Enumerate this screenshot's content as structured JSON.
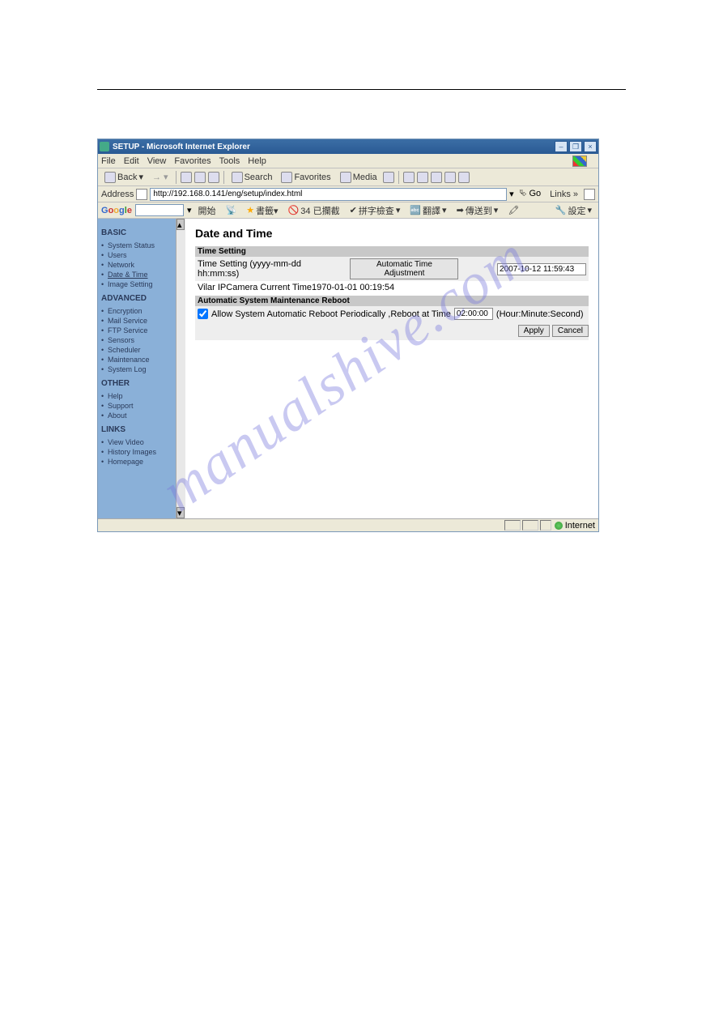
{
  "window": {
    "title": "SETUP - Microsoft Internet Explorer",
    "min": "–",
    "max": "❐",
    "close": "×"
  },
  "menubar": {
    "items": [
      "File",
      "Edit",
      "View",
      "Favorites",
      "Tools",
      "Help"
    ]
  },
  "toolbar": {
    "back": "Back",
    "search": "Search",
    "favorites": "Favorites",
    "media": "Media"
  },
  "addrbar": {
    "label": "Address",
    "url": "http://192.168.0.141/eng/setup/index.html",
    "go": "Go",
    "links": "Links »"
  },
  "googlebar": {
    "start": "開始",
    "count": "34 已攔截",
    "check": "拼字檢查",
    "trans": "翻譯",
    "send": "傳送到",
    "settings": "設定"
  },
  "sidebar": {
    "basic": {
      "title": "BASIC",
      "items": [
        "System Status",
        "Users",
        "Network",
        "Date & Time",
        "Image Setting"
      ],
      "activeIndex": 3
    },
    "advanced": {
      "title": "ADVANCED",
      "items": [
        "Encryption",
        "Mail Service",
        "FTP Service",
        "Sensors",
        "Scheduler",
        "Maintenance",
        "System Log"
      ]
    },
    "other": {
      "title": "OTHER",
      "items": [
        "Help",
        "Support",
        "About"
      ]
    },
    "links": {
      "title": "LINKS",
      "items": [
        "View Video",
        "History Images",
        "Homepage"
      ]
    }
  },
  "main": {
    "title": "Date and Time",
    "timeSettingHeader": "Time Setting",
    "timeSettingLabel": "Time Setting (yyyy-mm-dd hh:mm:ss)",
    "autoAdjustBtn": "Automatic Time Adjustment",
    "timeValue": "2007-10-12 11:59:43",
    "currentTimeText": "Vilar IPCamera Current Time1970-01-01 00:19:54",
    "rebootHeader": "Automatic System Maintenance Reboot",
    "rebootChecked": true,
    "rebootLabel": "Allow System Automatic Reboot Periodically ,Reboot at Time",
    "rebootTime": "02:00:00",
    "rebootUnits": "(Hour:Minute:Second)",
    "apply": "Apply",
    "cancel": "Cancel"
  },
  "statusbar": {
    "zone": "Internet"
  },
  "watermark": "manualshive.com"
}
